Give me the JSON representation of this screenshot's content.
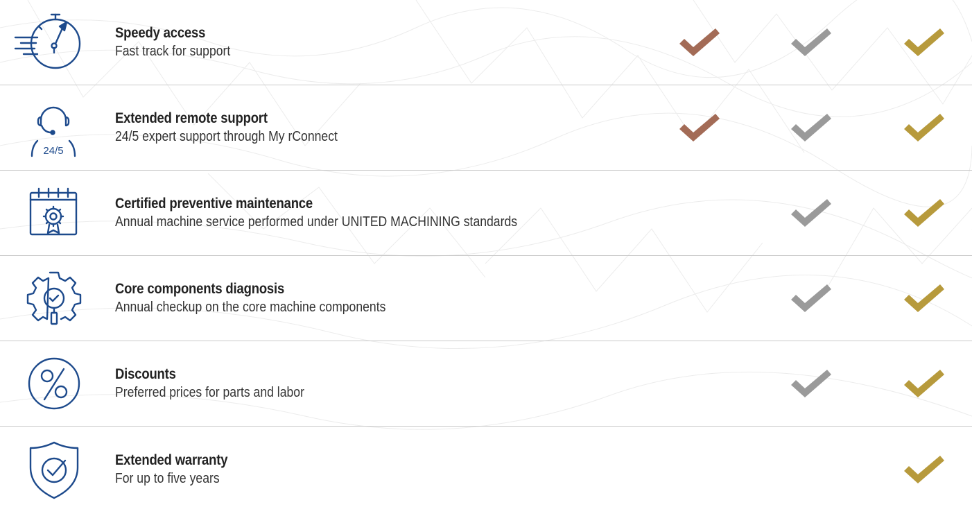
{
  "colors": {
    "icon_blue": "#1d4a8c",
    "tier_1": "#a36b56",
    "tier_2": "#9a9a9a",
    "tier_3": "#b79a3c",
    "divider": "#c9c9c9"
  },
  "features": [
    {
      "icon": "stopwatch-speed-icon",
      "title": "Speedy access",
      "description": "Fast track for support",
      "tiers": [
        true,
        true,
        true
      ]
    },
    {
      "icon": "headset-support-icon",
      "icon_label": "24/5",
      "title": "Extended remote support",
      "description": "24/5 expert support through My rConnect",
      "tiers": [
        true,
        true,
        true
      ]
    },
    {
      "icon": "calendar-gear-certified-icon",
      "title": "Certified preventive maintenance",
      "description": "Annual machine service performed under UNITED MACHINING standards",
      "tiers": [
        false,
        true,
        true
      ]
    },
    {
      "icon": "gear-magnifier-check-icon",
      "title": "Core components diagnosis",
      "description": "Annual checkup on the core machine components",
      "tiers": [
        false,
        true,
        true
      ]
    },
    {
      "icon": "percent-discount-icon",
      "title": "Discounts",
      "description": "Preferred prices for parts and labor",
      "tiers": [
        false,
        true,
        true
      ]
    },
    {
      "icon": "shield-check-icon",
      "title": "Extended warranty",
      "description": "For up to five years",
      "tiers": [
        false,
        false,
        true
      ]
    }
  ]
}
